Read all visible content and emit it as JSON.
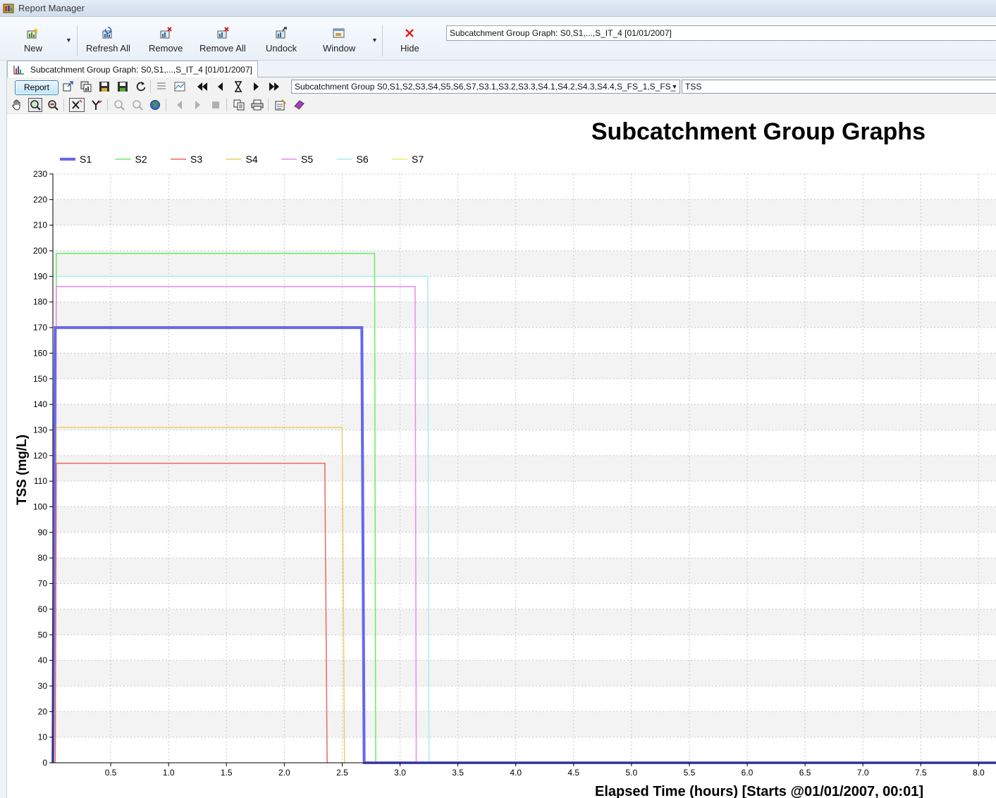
{
  "window": {
    "title": "Report Manager"
  },
  "toolbar": {
    "new_label": "New",
    "refresh_all_label": "Refresh All",
    "remove_label": "Remove",
    "remove_all_label": "Remove All",
    "undock_label": "Undock",
    "window_label": "Window",
    "hide_label": "Hide",
    "report_combo_value": "Subcatchment Group Graph: S0,S1,...,S_IT_4 [01/01/2007]"
  },
  "tab": {
    "label": "Subcatchment Group Graph: S0,S1,...,S_IT_4 [01/01/2007]"
  },
  "graph_toolbar": {
    "report_button": "Report",
    "group_select_value": "Subcatchment Group S0,S1,S2,S3,S4,S5,S6,S7,S3.1,S3.2,S3.3,S4.1,S4.2,S4.3,S4.4,S_FS_1,S_FS_",
    "parameter_select_value": "TSS"
  },
  "colors": {
    "S1": "#6666ee",
    "S2": "#66ee66",
    "S3": "#ee6666",
    "S4": "#eecc66",
    "S5": "#ee88ee",
    "S6": "#aaeeee",
    "S7": "#eeee66",
    "plot_band": "#f3f3f3",
    "grid": "#c8c8c8"
  },
  "chart_data": {
    "type": "line",
    "title": "Subcatchment Group Graphs",
    "xlabel": "Elapsed Time (hours) [Starts @01/01/2007, 00:01]",
    "ylabel": "TSS (mg/L)",
    "xlim": [
      0.0,
      8.15
    ],
    "ylim": [
      0,
      230
    ],
    "x_ticks": [
      "0.5",
      "1.0",
      "1.5",
      "2.0",
      "2.5",
      "3.0",
      "3.5",
      "4.0",
      "4.5",
      "5.0",
      "5.5",
      "6.0",
      "6.5",
      "7.0",
      "7.5",
      "8.0"
    ],
    "y_ticks": [
      "0",
      "10",
      "20",
      "30",
      "40",
      "50",
      "60",
      "70",
      "80",
      "90",
      "100",
      "110",
      "120",
      "130",
      "140",
      "150",
      "160",
      "170",
      "180",
      "190",
      "200",
      "210",
      "220",
      "230"
    ],
    "grid": true,
    "legend_position": "top-left",
    "series": [
      {
        "name": "S1",
        "x": [
          0.0,
          0.02,
          2.67,
          2.69,
          8.15
        ],
        "y": [
          0,
          170,
          170,
          0,
          0
        ]
      },
      {
        "name": "S2",
        "x": [
          0.02,
          0.03,
          2.78,
          2.79
        ],
        "y": [
          0,
          199,
          199,
          0
        ]
      },
      {
        "name": "S3",
        "x": [
          0.02,
          0.03,
          2.35,
          2.37
        ],
        "y": [
          0,
          117,
          117,
          0
        ]
      },
      {
        "name": "S4",
        "x": [
          0.02,
          0.03,
          2.5,
          2.52
        ],
        "y": [
          0,
          131,
          131,
          0
        ]
      },
      {
        "name": "S5",
        "x": [
          0.02,
          0.03,
          3.13,
          3.14
        ],
        "y": [
          0,
          186,
          186,
          0
        ]
      },
      {
        "name": "S6",
        "x": [
          0.02,
          0.03,
          3.24,
          3.25
        ],
        "y": [
          0,
          190,
          190,
          0
        ]
      },
      {
        "name": "S7",
        "x": [],
        "y": []
      }
    ]
  }
}
